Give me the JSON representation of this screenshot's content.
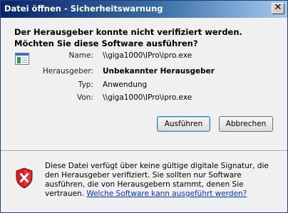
{
  "window": {
    "title": "Datei öffnen - Sicherheitswarnung",
    "close_glyph": "✕"
  },
  "message": {
    "headline": "Der Herausgeber konnte nicht verifiziert werden. Möchten Sie diese Software ausführen?"
  },
  "details": {
    "name_label": "Name:",
    "name_value": "\\\\giga1000\\IPro\\ipro.exe",
    "publisher_label": "Herausgeber:",
    "publisher_value": "Unbekannter Herausgeber",
    "type_label": "Typ:",
    "type_value": "Anwendung",
    "from_label": "Von:",
    "from_value": "\\\\giga1000\\IPro\\ipro.exe"
  },
  "buttons": {
    "run": "Ausführen",
    "cancel": "Abbrechen"
  },
  "warning": {
    "text": "Diese Datei verfügt über keine gültige digitale Signatur, die den Herausgeber verifiziert. Sie sollten nur Software ausführen, die von Herausgebern stammt, denen Sie vertrauen. ",
    "link": "Welche Software kann ausgeführt werden?"
  },
  "icons": {
    "file": "application-window-icon",
    "warning": "red-shield-x-icon",
    "close": "close-icon"
  },
  "colors": {
    "titlebar": "#0a246a",
    "link": "#0033cc",
    "shield": "#d42020"
  }
}
